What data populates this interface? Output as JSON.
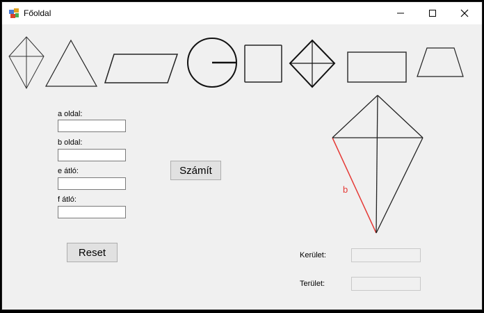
{
  "window": {
    "title": "Főoldal",
    "icons": [
      "app-icon",
      "minimize-icon",
      "maximize-icon",
      "close-icon"
    ]
  },
  "shape_toolbar": {
    "items": [
      "kite-shape",
      "triangle-shape",
      "parallelogram-shape",
      "circle-shape",
      "square-shape",
      "rhombus-shape",
      "rectangle-shape",
      "trapezoid-shape"
    ]
  },
  "form": {
    "a_label": "a oldal:",
    "a_value": "",
    "b_label": "b oldal:",
    "b_value": "",
    "e_label": "e átló:",
    "e_value": "",
    "f_label": "f átló:",
    "f_value": "",
    "calc_button": "Számít",
    "reset_button": "Reset"
  },
  "diagram": {
    "highlight_label": "b",
    "highlight_color": "#e53935"
  },
  "results": {
    "perimeter_label": "Kerület:",
    "perimeter_value": "",
    "area_label": "Terület:",
    "area_value": ""
  }
}
